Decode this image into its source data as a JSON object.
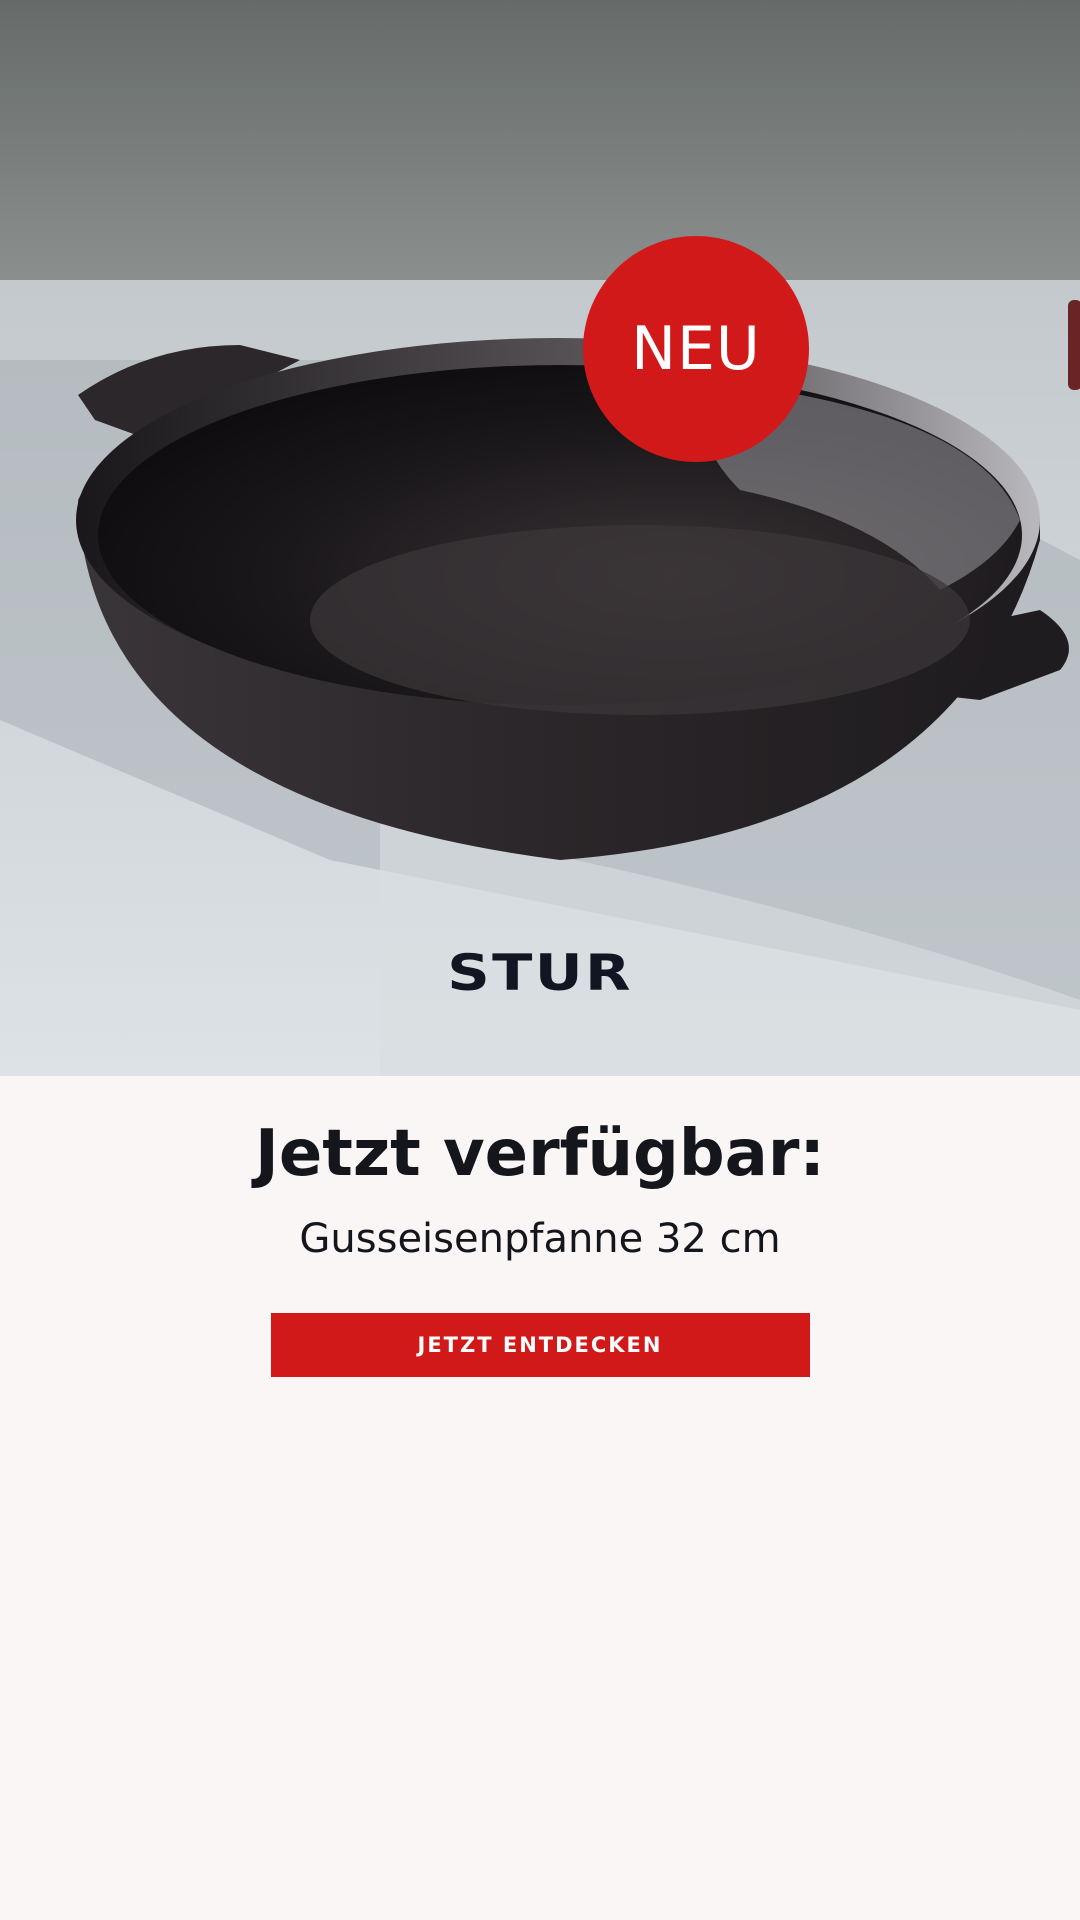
{
  "hero": {
    "badge_text": "NEU",
    "brand_logo": "STUR",
    "image_subject": "cast-iron-pan"
  },
  "content": {
    "headline": "Jetzt verfügbar:",
    "subline": "Gusseisenpfanne 32 cm",
    "cta_label": "JETZT ENTDECKEN"
  },
  "colors": {
    "accent": "#d2191a",
    "text": "#14161c",
    "background": "#faf6f5",
    "logo": "#101622"
  }
}
